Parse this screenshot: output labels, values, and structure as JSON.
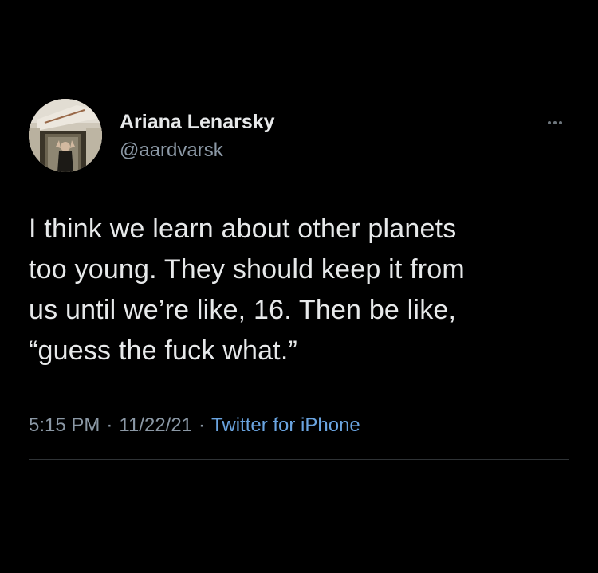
{
  "tweet": {
    "author": {
      "display_name": "Ariana Lenarsky",
      "handle": "@aardvarsk",
      "avatar_icon": "profile-photo"
    },
    "more_icon": "ellipsis-icon",
    "text": "I think we learn about other planets\ntoo young. They should keep it from\nus until we’re like, 16. Then be like,\n“guess the fuck what.”",
    "time": "5:15 PM",
    "separator": "·",
    "date": "11/22/21",
    "source": "Twitter for iPhone"
  },
  "colors": {
    "background": "#000000",
    "primary_text": "#e7e9ea",
    "secondary_text": "#8b98a5",
    "link": "#6aa4e0",
    "divider": "#2f3336"
  }
}
